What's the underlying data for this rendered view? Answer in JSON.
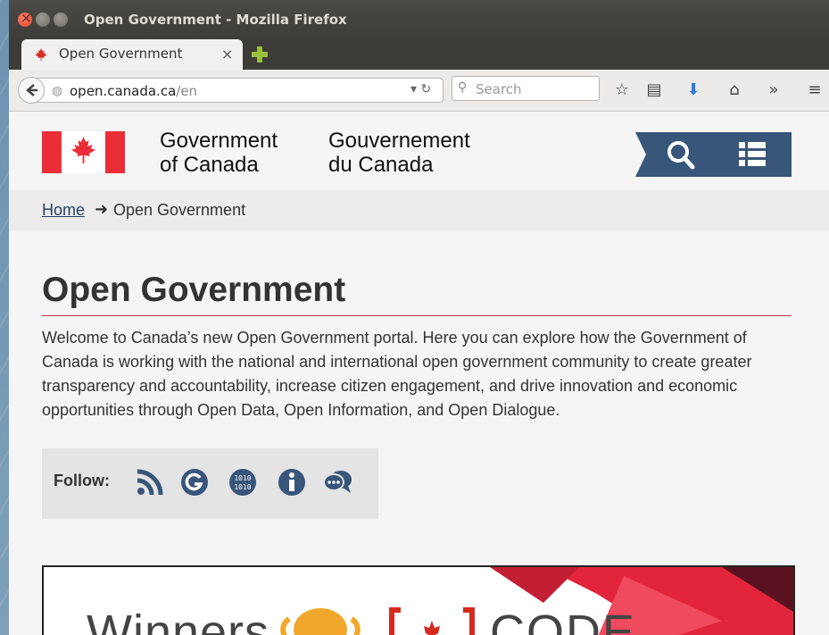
{
  "window": {
    "title": "Open Government - Mozilla Firefox"
  },
  "tab": {
    "label": "Open Government",
    "close_glyph": "×"
  },
  "nav": {
    "url_host": "open.canada.ca",
    "url_path": "/en",
    "search_placeholder": "Search"
  },
  "header": {
    "gov_en_line1": "Government",
    "gov_en_line2": "of Canada",
    "gov_fr_line1": "Gouvernement",
    "gov_fr_line2": "du Canada"
  },
  "breadcrumb": {
    "home": "Home",
    "current": "Open Government"
  },
  "main": {
    "title": "Open Government",
    "intro": "Welcome to Canada’s new Open Government portal. Here you can explore how the Government of Canada is working with the national and international open government community to create greater transparency and accountability, increase citizen engagement, and drive innovation and economic opportunities through Open Data, Open Information, and Open Dialogue.",
    "follow_label": "Follow:"
  },
  "banner": {
    "text_left": "Winners",
    "text_right": "CODE"
  },
  "colors": {
    "gc_red": "#eb2d37",
    "gc_navy": "#26374a",
    "rule": "#af3c43"
  },
  "icons": [
    "rss-icon",
    "google-plus-icon",
    "open-data-icon",
    "info-icon",
    "dialogue-icon"
  ]
}
